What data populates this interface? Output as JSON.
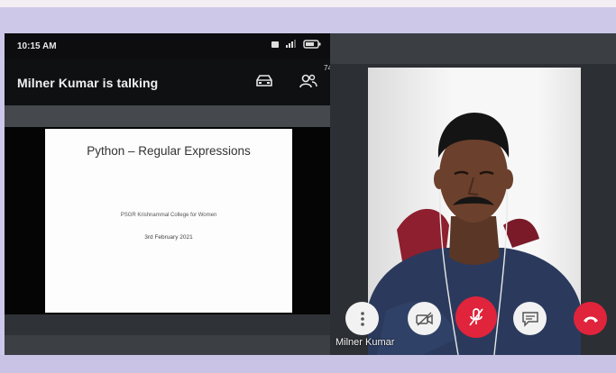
{
  "status_bar": {
    "time": "10:15 AM"
  },
  "call": {
    "talking_text": "Milner Kumar is talking",
    "participants_count": "74"
  },
  "slide": {
    "title": "Python – Regular Expressions",
    "subtitle": "PSGR Krishnammal College for Women",
    "date": "3rd February 2021"
  },
  "video": {
    "participant_name": "Milner Kumar"
  },
  "controls": [
    {
      "name": "more-options-icon",
      "style": "white"
    },
    {
      "name": "camera-off-icon",
      "style": "white"
    },
    {
      "name": "mic-muted-icon",
      "style": "red"
    },
    {
      "name": "chat-icon",
      "style": "white"
    },
    {
      "name": "hang-up-icon",
      "style": "red"
    }
  ],
  "colors": {
    "background": "#cdc8e8",
    "accent_red": "#e0243b",
    "dark": "#0f1012"
  }
}
